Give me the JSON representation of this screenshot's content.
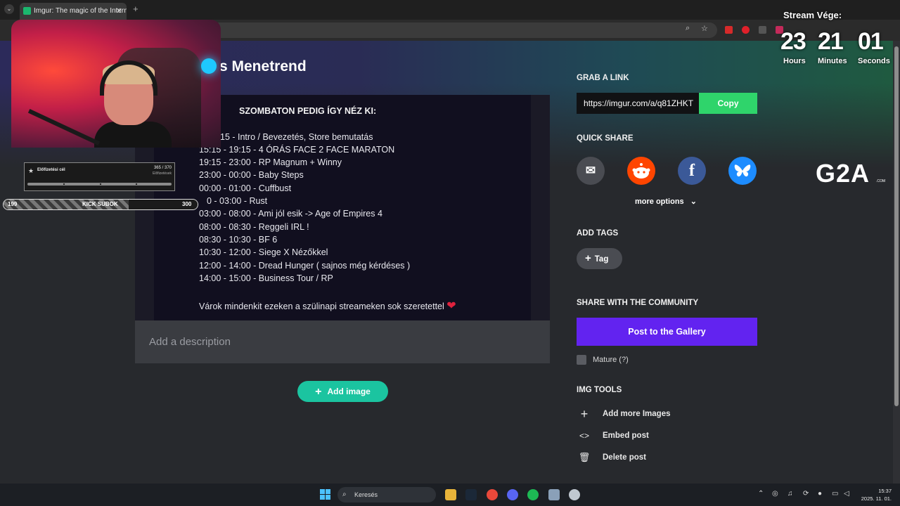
{
  "browser": {
    "tab_title": "Imgur: The magic of the Internet",
    "tab_close": "✕",
    "new_tab": "+",
    "tab_menu": "⌄"
  },
  "post": {
    "title": "s Menetrend",
    "image_text": {
      "heading": "SZOMBATON PEDIG ÍGY NÉZ KI:",
      "lines": [
        "15 - Intro / Bevezetés, Store bemutatás",
        "15:15 - 19:15 - 4 ÓRÁS FACE 2 FACE MARATON",
        "19:15 - 23:00 - RP Magnum + Winny",
        "23:00 - 00:00 - Baby Steps",
        "00:00 - 01:00 - Cuffbust",
        "0 - 03:00 - Rust",
        "03:00 - 08:00 - Ami jól esik -> Age of Empires 4",
        "08:00 - 08:30 - Reggeli IRL !",
        "08:30 - 10:30 - BF 6",
        "10:30 - 12:00 - Siege X Nézőkkel",
        "12:00 - 14:00 - Dread Hunger ( sajnos még kérdéses )",
        "14:00 - 15:00 - Business Tour / RP"
      ],
      "closing": "Várok mindenkit ezeken a szülinapi streameken sok szeretettel",
      "heart": "❤"
    },
    "description_placeholder": "Add a description",
    "add_image_label": "Add image",
    "add_image_icon": "+"
  },
  "sidebar": {
    "grab_link_label": "GRAB A LINK",
    "link_url": "https://imgur.com/a/q81ZHKT",
    "copy_label": "Copy",
    "quick_share_label": "QUICK SHARE",
    "share_icons": [
      {
        "name": "email",
        "glyph": "✉",
        "color": "#4a4c52"
      },
      {
        "name": "reddit",
        "glyph": "●",
        "color": "#ff4500"
      },
      {
        "name": "facebook",
        "glyph": "f",
        "color": "#3b5998"
      },
      {
        "name": "bluesky",
        "glyph": "🦋",
        "color": "#1d8cff"
      }
    ],
    "more_options_label": "more options",
    "more_options_icon": "⌄",
    "add_tags_label": "ADD TAGS",
    "tag_button_label": "Tag",
    "tag_button_icon": "+",
    "share_community_label": "SHARE WITH THE COMMUNITY",
    "gallery_button_label": "Post to the Gallery",
    "mature_label": "Mature (?)",
    "img_tools_label": "IMG TOOLS",
    "tools": [
      {
        "label": "Add more Images",
        "icon": "+"
      },
      {
        "label": "Embed post",
        "icon": "<>"
      },
      {
        "label": "Delete post",
        "icon": "🗑"
      }
    ]
  },
  "overlay": {
    "subs_title": "Előfizetési cél",
    "subs_count": "365 / 370",
    "subs_sub": "Előfizetések",
    "subs_progress": 0.99,
    "kick_left": "199",
    "kick_mid": "KICK SUBOK",
    "kick_right": "300",
    "timer_title": "Stream Vége:",
    "hours": "23",
    "minutes": "21",
    "seconds": "01",
    "hours_label": "Hours",
    "minutes_label": "Minutes",
    "seconds_label": "Seconds",
    "sponsor": "G2A",
    "sponsor_sub": ".COM"
  },
  "taskbar": {
    "search_label": "Keresés",
    "time": "15:37",
    "date": "2025. 11. 01."
  },
  "colors": {
    "accent_green": "#2fd46b",
    "teal": "#1bc4a0",
    "purple": "#6223f0"
  }
}
